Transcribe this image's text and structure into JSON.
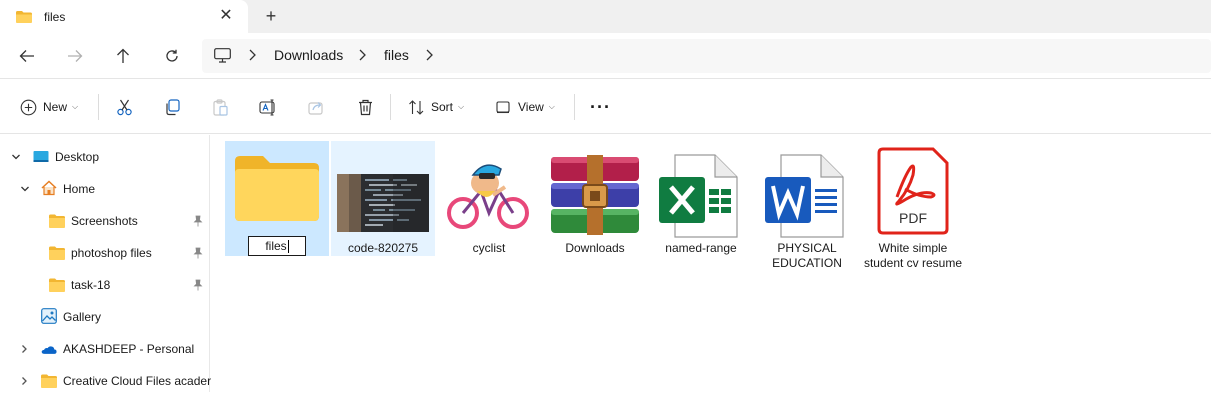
{
  "tab": {
    "title": "files",
    "close_glyph": "✕",
    "add_glyph": "+"
  },
  "nav": {
    "back": "arrow-left-icon",
    "forward": "arrow-right-icon",
    "up": "arrow-up-icon",
    "refresh": "refresh-icon"
  },
  "breadcrumb": {
    "items": [
      "Downloads",
      "files"
    ]
  },
  "toolbar": {
    "new_label": "New",
    "sort_label": "Sort",
    "view_label": "View",
    "more_glyph": "···"
  },
  "sidebar": {
    "items": [
      {
        "label": "Desktop"
      },
      {
        "label": "Home"
      },
      {
        "label": "Screenshots"
      },
      {
        "label": "photoshop files"
      },
      {
        "label": "task-18"
      },
      {
        "label": "Gallery"
      },
      {
        "label": "AKASHDEEP - Personal"
      },
      {
        "label": "Creative Cloud Files  acader"
      }
    ]
  },
  "files": [
    {
      "name": "files",
      "kind": "folder",
      "state": "renaming"
    },
    {
      "name": "code-820275",
      "kind": "image"
    },
    {
      "name": "cyclist",
      "kind": "image"
    },
    {
      "name": "Downloads",
      "kind": "winrar-archive"
    },
    {
      "name": "named-range",
      "kind": "excel"
    },
    {
      "name": "PHYSICAL EDUCATION",
      "kind": "word"
    },
    {
      "name": "White simple student cv resume",
      "kind": "pdf"
    }
  ],
  "pdf_badge": "PDF",
  "colors": {
    "selection": "#cce8ff",
    "folder": "#f7c948",
    "excel": "#107c41",
    "word": "#185abd",
    "pdf": "#e0231a",
    "onedrive": "#0a64c8"
  }
}
